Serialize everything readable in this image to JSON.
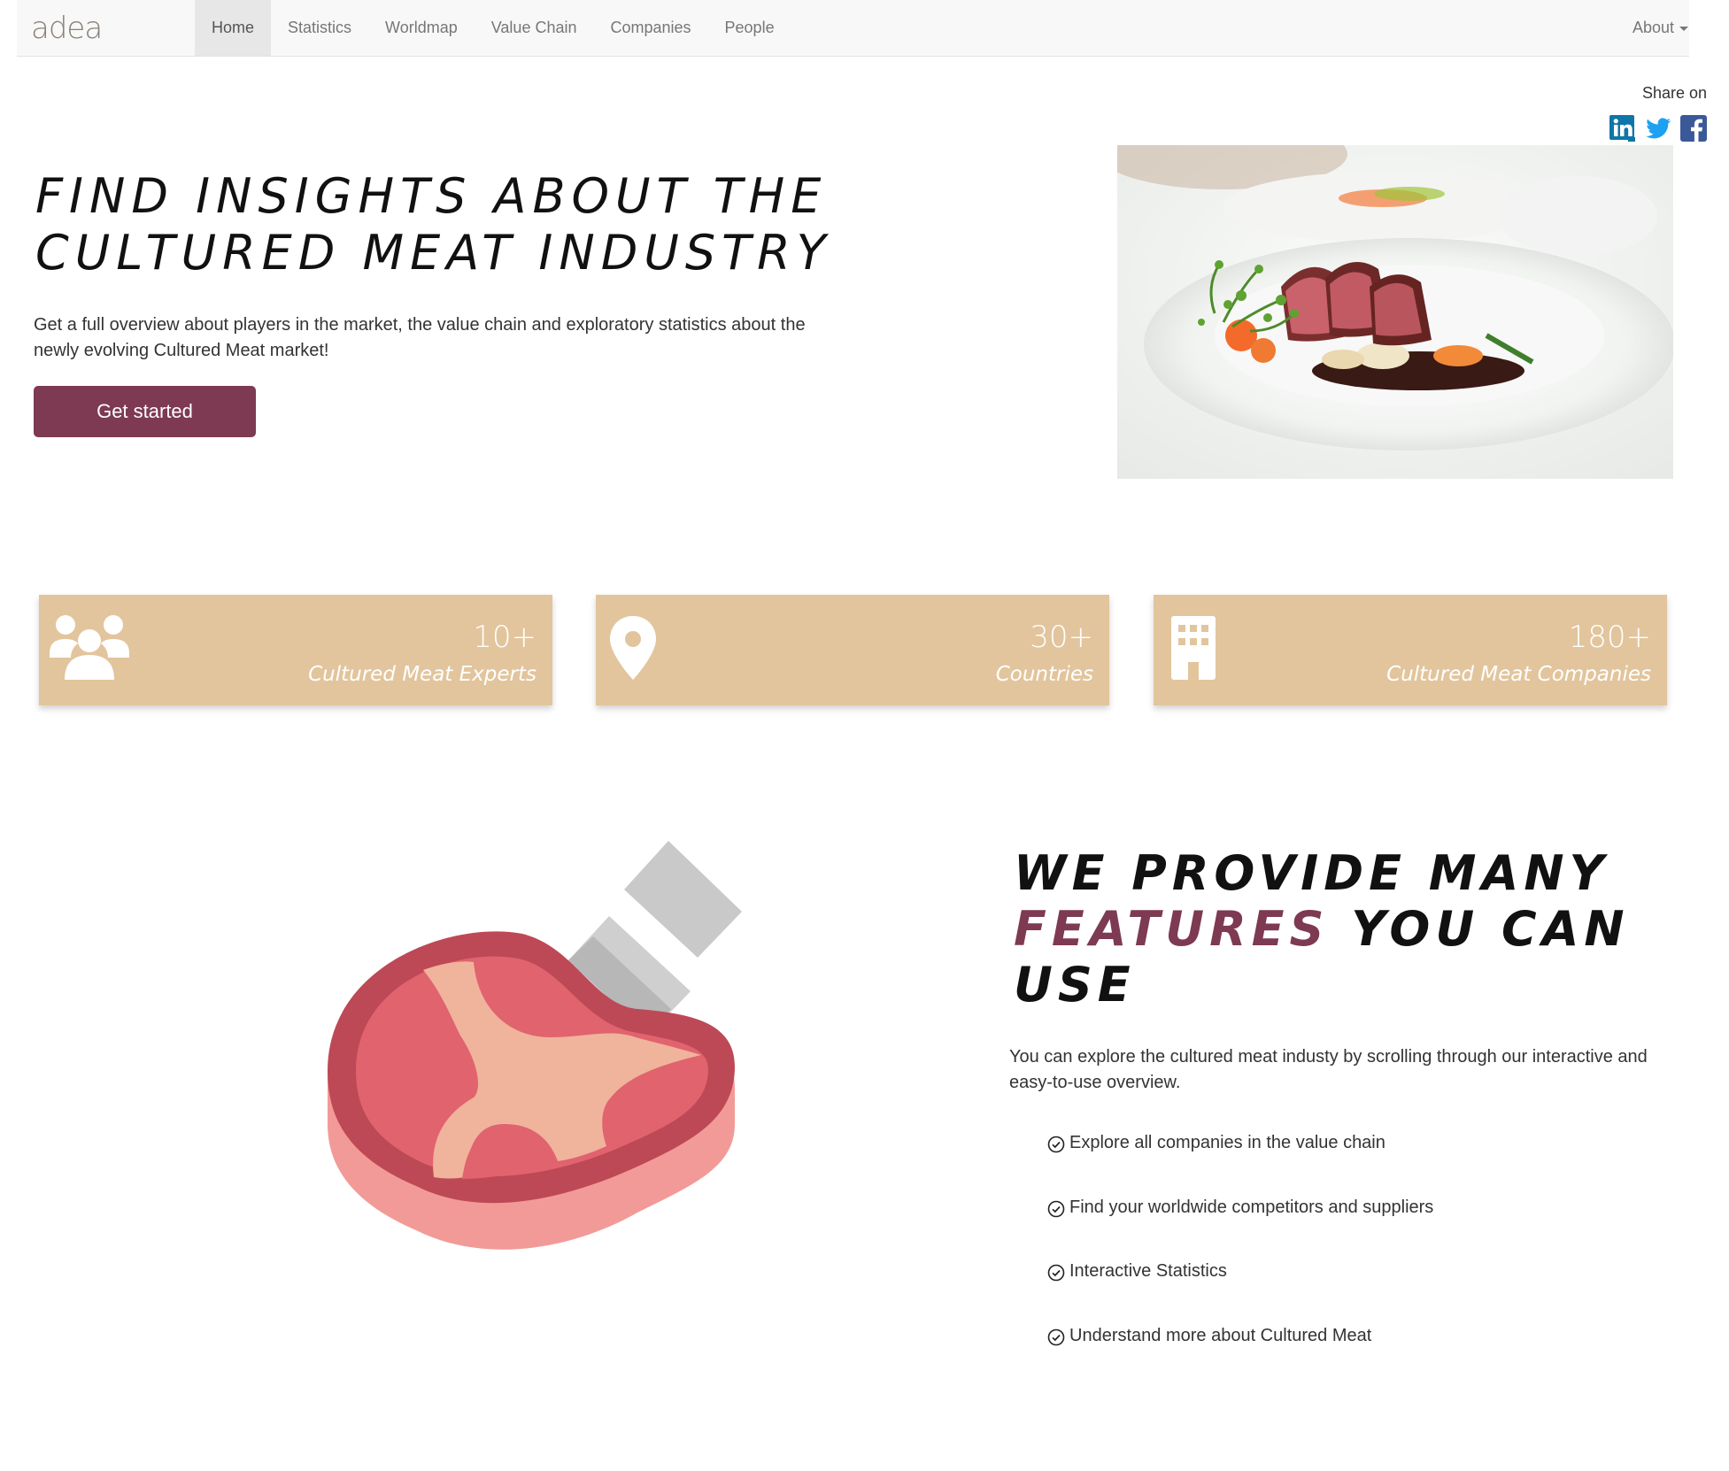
{
  "navbar": {
    "brand": "adea",
    "items": [
      {
        "label": "Home",
        "active": true
      },
      {
        "label": "Statistics",
        "active": false
      },
      {
        "label": "Worldmap",
        "active": false
      },
      {
        "label": "Value Chain",
        "active": false
      },
      {
        "label": "Companies",
        "active": false
      },
      {
        "label": "People",
        "active": false
      }
    ],
    "about_label": "About"
  },
  "share": {
    "label": "Share on",
    "icons": [
      "linkedin-icon",
      "twitter-icon",
      "facebook-icon"
    ]
  },
  "hero": {
    "title_line1": "FIND INSIGHTS ABOUT THE",
    "title_line2": "CULTURED MEAT INDUSTRY",
    "description": "Get a full overview about players in the market, the value chain and exploratory statistics about the newly evolving Cultured Meat market!",
    "button_label": "Get started"
  },
  "stats": [
    {
      "number": "10+",
      "label": "Cultured Meat Experts",
      "icon": "users-icon"
    },
    {
      "number": "30+",
      "label": "Countries",
      "icon": "map-pin-icon"
    },
    {
      "number": "180+",
      "label": "Cultured Meat Companies",
      "icon": "building-icon"
    }
  ],
  "features": {
    "title_line1": "WE PROVIDE MANY",
    "title_accent": "FEATURES",
    "title_rest": " YOU CAN",
    "title_line3": "USE",
    "description": "You can explore the cultured meat industy by scrolling through our interactive and easy-to-use overview.",
    "items": [
      "Explore all companies in the value chain",
      "Find your worldwide competitors and suppliers",
      "Interactive Statistics",
      "Understand more about Cultured Meat"
    ]
  },
  "colors": {
    "accent": "#7d3a52",
    "card": "#e2c59d",
    "navbar": "#f8f8f8"
  }
}
